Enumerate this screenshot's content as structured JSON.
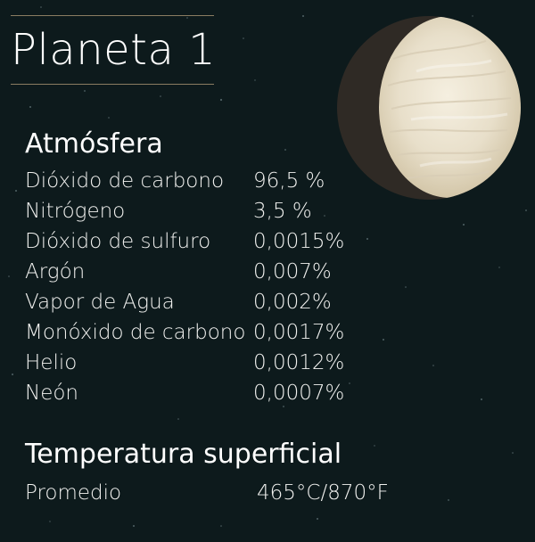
{
  "title": "Planeta 1",
  "atmosphere": {
    "heading": "Atmósfera",
    "rows": [
      {
        "label": "Dióxido de carbono",
        "value": "96,5 %"
      },
      {
        "label": "Nitrógeno",
        "value": "3,5 %"
      },
      {
        "label": "Dióxido de sulfuro",
        "value": "0,0015%"
      },
      {
        "label": "Argón",
        "value": "0,007%"
      },
      {
        "label": "Vapor de Agua",
        "value": "0,002%"
      },
      {
        "label": "Monóxido de carbono",
        "value": "0,0017%"
      },
      {
        "label": "Helio",
        "value": "0,0012%"
      },
      {
        "label": "Neón",
        "value": "0,0007%"
      }
    ]
  },
  "temperature": {
    "heading": "Temperatura superficial",
    "label": "Promedio",
    "value": "465°C/870°F"
  },
  "colors": {
    "background": "#0d1a1c",
    "text": "#ffffff",
    "rule": "#8a7c62",
    "planet_light": "#ece5d2",
    "planet_shadow": "#2f2a25"
  },
  "icons": {
    "planet": "planet-illustration"
  }
}
